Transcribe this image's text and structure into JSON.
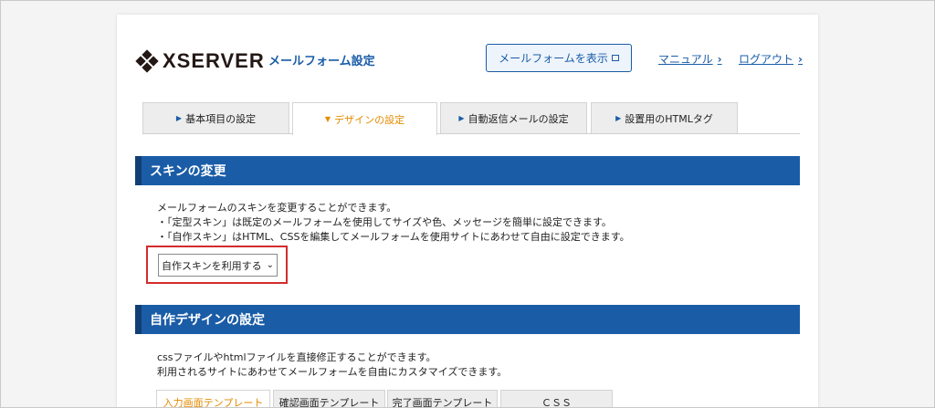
{
  "header": {
    "logo_text": "XSERVER",
    "app_title": "メールフォーム設定",
    "show_form_label": "メールフォームを表示",
    "manual_label": "マニュアル",
    "logout_label": "ログアウト"
  },
  "tabs": [
    {
      "label": "基本項目の設定",
      "active": false
    },
    {
      "label": "デザインの設定",
      "active": true
    },
    {
      "label": "自動返信メールの設定",
      "active": false
    },
    {
      "label": "設置用のHTMLタグ",
      "active": false
    }
  ],
  "skin_section": {
    "title": "スキンの変更",
    "lines": [
      "メールフォームのスキンを変更することができます。",
      "・「定型スキン」は既定のメールフォームを使用してサイズや色、メッセージを簡単に設定できます。",
      "・「自作スキン」はHTML、CSSを編集してメールフォームを使用サイトにあわせて自由に設定できます。"
    ],
    "select_value": "自作スキンを利用する"
  },
  "custom_section": {
    "title": "自作デザインの設定",
    "lines": [
      "cssファイルやhtmlファイルを直接修正することができます。",
      "利用されるサイトにあわせてメールフォームを自由にカスタマイズできます。"
    ]
  },
  "subtabs": [
    {
      "label": "入力画面テンプレート",
      "active": true
    },
    {
      "label": "確認画面テンプレート",
      "active": false
    },
    {
      "label": "完了画面テンプレート",
      "active": false
    },
    {
      "label": "ＣＳＳ",
      "active": false
    }
  ],
  "colors": {
    "brand_blue": "#1a5ca6",
    "active_tab_orange": "#e38b00",
    "highlight_red": "#d42c2c"
  }
}
